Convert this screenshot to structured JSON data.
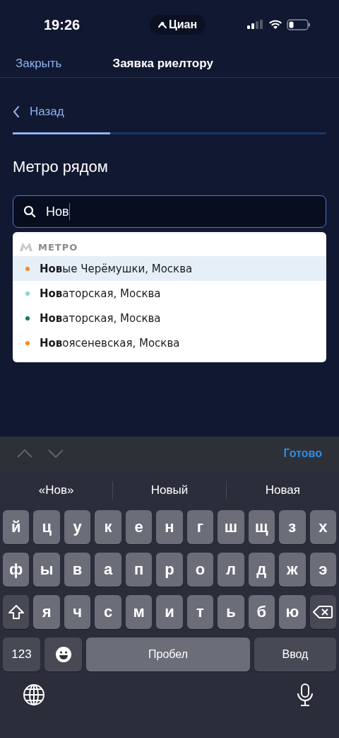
{
  "status_bar": {
    "time": "19:26",
    "app_pill": "Циан"
  },
  "nav": {
    "close": "Закрыть",
    "title": "Заявка риелтору"
  },
  "back": "Назад",
  "progress": {
    "level": 0.31
  },
  "heading": "Метро рядом",
  "search": {
    "value": "Нов"
  },
  "dropdown": {
    "section": "МЕТРО",
    "items": [
      {
        "text": "**Нов**ые Черёмушки, Москва",
        "color": "#f08a24",
        "selected": true
      },
      {
        "text": "**Нов**аторская, Москва",
        "color": "#8ccfd6",
        "selected": false
      },
      {
        "text": "**Нов**аторская, Москва",
        "color": "#127a5a",
        "selected": false
      },
      {
        "text": "**Нов**оясеневская, Москва",
        "color": "#f08a24",
        "selected": false
      }
    ]
  },
  "keyboard_toolbar": {
    "done": "Готово"
  },
  "suggestions": [
    "«Нов»",
    "Новый",
    "Новая"
  ],
  "key_rows": [
    [
      {
        "kind": "letter",
        "label": "й"
      },
      {
        "kind": "letter",
        "label": "ц"
      },
      {
        "kind": "letter",
        "label": "у"
      },
      {
        "kind": "letter",
        "label": "к"
      },
      {
        "kind": "letter",
        "label": "е"
      },
      {
        "kind": "letter",
        "label": "н"
      },
      {
        "kind": "letter",
        "label": "г"
      },
      {
        "kind": "letter",
        "label": "ш"
      },
      {
        "kind": "letter",
        "label": "щ"
      },
      {
        "kind": "letter",
        "label": "з"
      },
      {
        "kind": "letter",
        "label": "х"
      }
    ],
    [
      {
        "kind": "letter",
        "label": "ф"
      },
      {
        "kind": "letter",
        "label": "ы"
      },
      {
        "kind": "letter",
        "label": "в"
      },
      {
        "kind": "letter",
        "label": "а"
      },
      {
        "kind": "letter",
        "label": "п"
      },
      {
        "kind": "letter",
        "label": "р"
      },
      {
        "kind": "letter",
        "label": "о"
      },
      {
        "kind": "letter",
        "label": "л"
      },
      {
        "kind": "letter",
        "label": "д"
      },
      {
        "kind": "letter",
        "label": "ж"
      },
      {
        "kind": "letter",
        "label": "э"
      }
    ],
    [
      {
        "kind": "shift"
      },
      {
        "kind": "letter",
        "label": "я"
      },
      {
        "kind": "letter",
        "label": "ч"
      },
      {
        "kind": "letter",
        "label": "с"
      },
      {
        "kind": "letter",
        "label": "м"
      },
      {
        "kind": "letter",
        "label": "и"
      },
      {
        "kind": "letter",
        "label": "т"
      },
      {
        "kind": "letter",
        "label": "ь"
      },
      {
        "kind": "letter",
        "label": "б"
      },
      {
        "kind": "letter",
        "label": "ю"
      },
      {
        "kind": "backspace"
      }
    ],
    [
      {
        "kind": "numbers",
        "label": "123"
      },
      {
        "kind": "emoji"
      },
      {
        "kind": "space",
        "label": "Пробел"
      },
      {
        "kind": "return",
        "label": "Ввод"
      }
    ]
  ]
}
